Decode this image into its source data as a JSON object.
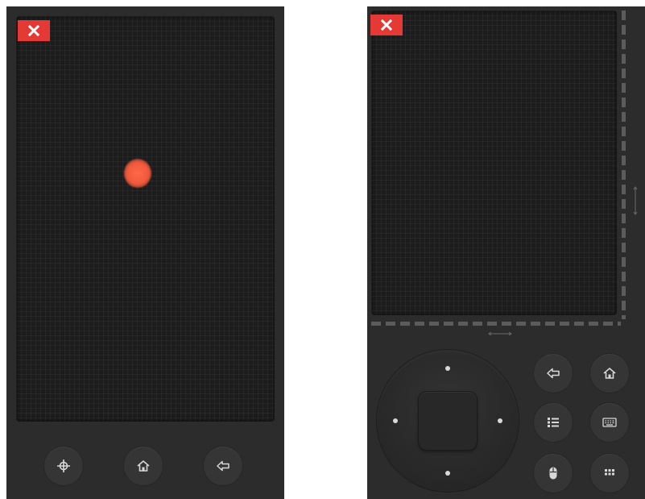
{
  "colors": {
    "panel_bg": "#2c2c2c",
    "pad_bg": "#1c1c1c",
    "close_red": "#e53935",
    "touch_dot": "#f0583a",
    "icon_light": "#d8d8d8"
  },
  "left_panel": {
    "close_icon": "close-icon",
    "touch_indicator": "touch-point",
    "buttons": [
      {
        "icon": "crosshair-move-icon"
      },
      {
        "icon": "home-icon"
      },
      {
        "icon": "back-arrow-icon"
      }
    ]
  },
  "right_panel": {
    "close_icon": "close-icon",
    "scrollbars": [
      "vertical-scroll-strip",
      "horizontal-scroll-strip"
    ],
    "dpad": {
      "directions": [
        "up",
        "down",
        "left",
        "right"
      ],
      "center": "select"
    },
    "buttons": [
      {
        "icon": "back-arrow-icon"
      },
      {
        "icon": "home-icon"
      },
      {
        "icon": "menu-list-icon"
      },
      {
        "icon": "keyboard-icon"
      },
      {
        "icon": "mouse-icon"
      },
      {
        "icon": "app-grid-icon"
      }
    ]
  }
}
